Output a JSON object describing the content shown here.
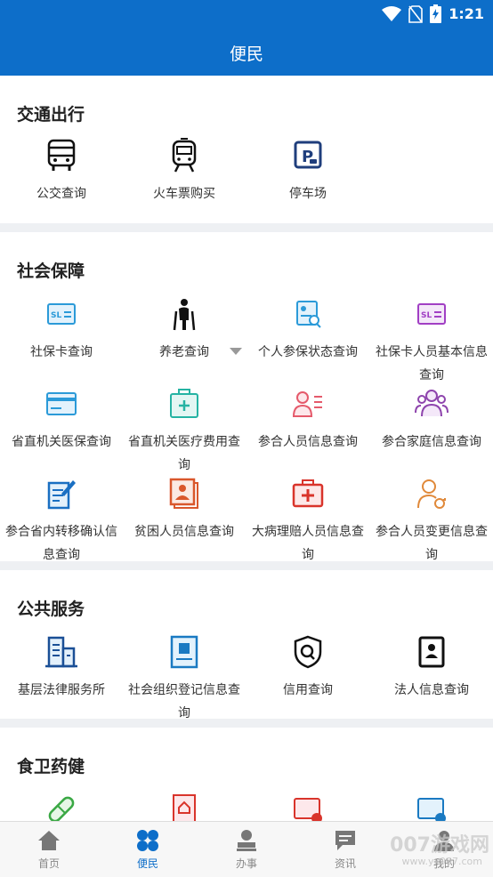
{
  "status": {
    "time": "1:21"
  },
  "title": "便民",
  "sections": {
    "traffic": {
      "title": "交通出行",
      "items": [
        "公交查询",
        "火车票购买",
        "停车场"
      ]
    },
    "social": {
      "title": "社会保障",
      "items": [
        "社保卡查询",
        "养老查询",
        "个人参保状态查询",
        "社保卡人员基本信息查询",
        "省直机关医保查询",
        "省直机关医疗费用查询",
        "参合人员信息查询",
        "参合家庭信息查询",
        "参合省内转移确认信息查询",
        "贫困人员信息查询",
        "大病理赔人员信息查询",
        "参合人员变更信息查询"
      ]
    },
    "public": {
      "title": "公共服务",
      "items": [
        "基层法律服务所",
        "社会组织登记信息查询",
        "信用查询",
        "法人信息查询"
      ]
    },
    "food": {
      "title": "食卫药健"
    }
  },
  "tabs": [
    "首页",
    "便民",
    "办事",
    "资讯",
    "我的"
  ],
  "watermark": {
    "brand": "007游戏网",
    "url": "www.yx007.com"
  },
  "colors": {
    "primary": "#0d6ec9",
    "background": "#eef0f3"
  }
}
